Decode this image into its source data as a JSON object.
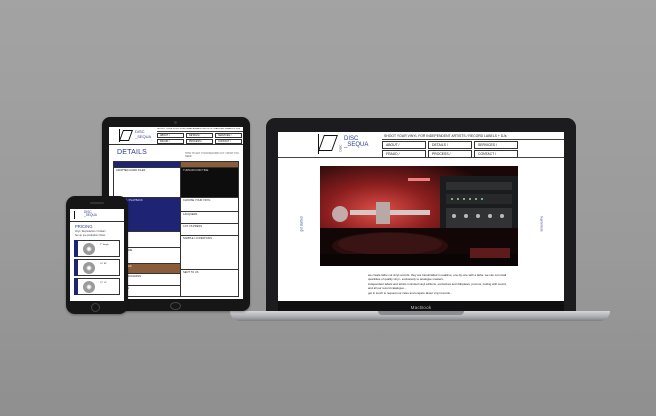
{
  "laptop": {
    "brand_logo": "DISC\n_SEQUA",
    "header_title": "SHOOT YOUR VINYL FOR INDEPENDENT ARTISTS / RECORD LABELS + DJs",
    "nav": [
      "ABOUT /",
      "DETAILS /",
      "SERVICES /",
      "FRAUD /",
      "PROCESS /",
      "CONTACT /"
    ],
    "side_left": "get started",
    "side_right": "learn more",
    "body_text": [
      "we create lathe cut vinyl records. they are handcrafted in realtime, one-by-one with a lathe. we can cut small quantities of quality vinyl - exclusively to analogue masters.",
      "independent labels and artists in limited vinyl editions, exclusives and dubplates, promos, cutting with sound, and all our record catalogue...",
      "get in touch to request our rates and enquire about vinyl records..."
    ],
    "brand_name": "MacBook"
  },
  "tablet": {
    "brand_logo": "DISC\n_SEQUA",
    "header_title": "SHOOT YOUR VINYL FOR INDEPENDENT ARTISTS / RECORD LABELS + DJs",
    "nav": [
      "ABOUT /",
      "DETAILS /",
      "SERVICES /",
      "FRAUD /",
      "PROCESS /",
      "CONTACT /"
    ],
    "page_title": "DETAILS",
    "page_sub": "HOW TO GET YOUR RECORD CUT / WHAT YOU NEED",
    "left_cells": [
      "ADOPTED AUDIO FILES",
      "QUALITY / PLAYBACK",
      "SIZES",
      "SINGLE SIDE",
      "QUANTITIES",
      "COVER PACKAGING",
      "COLOURS"
    ],
    "right_cells": [
      "TURNAROUND TIME",
      "CHOOSE YOUR VINYL",
      "LACQUERS",
      "CUT VS PRESS",
      "SAMPLE / CONDITIONS",
      "SENT TO US"
    ]
  },
  "phone": {
    "brand_logo": "DISC\n_SEQUA",
    "page_title": "PRICING",
    "lines": [
      "Vinyl / Reproduction / Contact",
      "Set up: pre-production / Discs"
    ],
    "cards": [
      "7\" Single",
      "10\" EP",
      "12\" LP"
    ]
  }
}
